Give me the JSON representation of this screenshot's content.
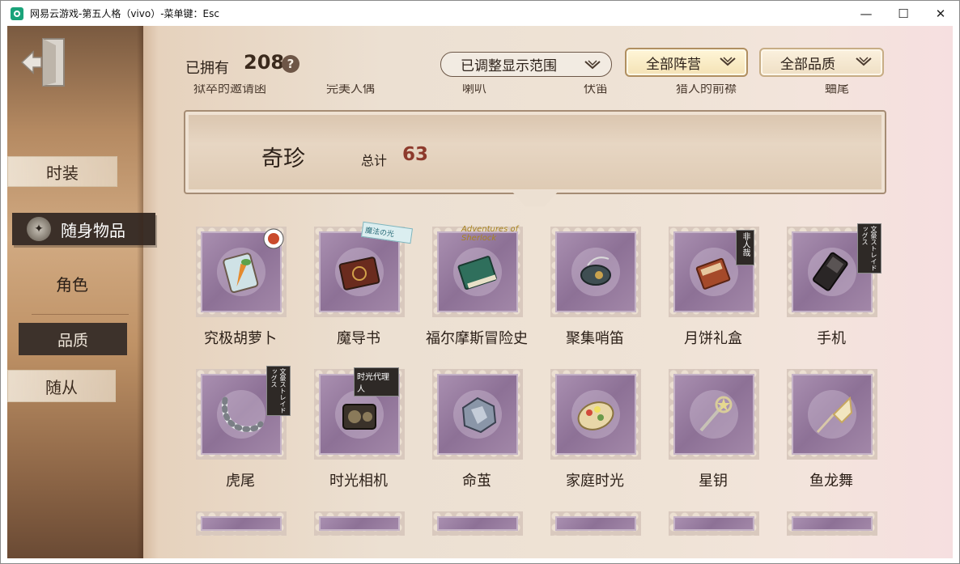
{
  "window": {
    "title": "网易云游戏-第五人格（vivo）-菜单键：Esc",
    "minimize": "—",
    "maximize": "☐",
    "close": "✕"
  },
  "nav": {
    "fashion": "时装",
    "carry": "随身物品",
    "role": "角色",
    "quality": "品质",
    "follower": "随从"
  },
  "header": {
    "owned_label": "已拥有",
    "owned_count": "208",
    "help": "?",
    "filters": {
      "range": "已调整显示范围",
      "camp": "全部阵营",
      "quality": "全部品质"
    }
  },
  "previous_row": [
    "狱卒的邀请函",
    "完美人偶",
    "喇叭",
    "伏笛",
    "猎人的前襟",
    "蛐尾"
  ],
  "section": {
    "title": "奇珍",
    "total_label": "总计",
    "total_count": "63"
  },
  "items": [
    {
      "name": "究极胡萝卜",
      "icon": "carrot-jar-icon"
    },
    {
      "name": "魔导书",
      "icon": "magic-book-icon"
    },
    {
      "name": "福尔摩斯冒险史",
      "icon": "green-book-icon"
    },
    {
      "name": "聚集哨笛",
      "icon": "whistle-icon"
    },
    {
      "name": "月饼礼盒",
      "icon": "mooncake-box-icon"
    },
    {
      "name": "手机",
      "icon": "phone-icon"
    },
    {
      "name": "虎尾",
      "icon": "tiger-tail-icon"
    },
    {
      "name": "时光相机",
      "icon": "camera-icon"
    },
    {
      "name": "命茧",
      "icon": "cocoon-icon"
    },
    {
      "name": "家庭时光",
      "icon": "flowers-icon"
    },
    {
      "name": "星钥",
      "icon": "star-key-icon"
    },
    {
      "name": "鱼龙舞",
      "icon": "fish-lantern-icon"
    }
  ],
  "tags": {
    "carrot": "",
    "book": "魔法の光",
    "holmes": "Adventures of Sherlock",
    "mooncake": "非人哉",
    "phone": "文豪ストレイドッグス",
    "tail": "文豪ストレイドッグス",
    "camera": "时光代理人"
  }
}
